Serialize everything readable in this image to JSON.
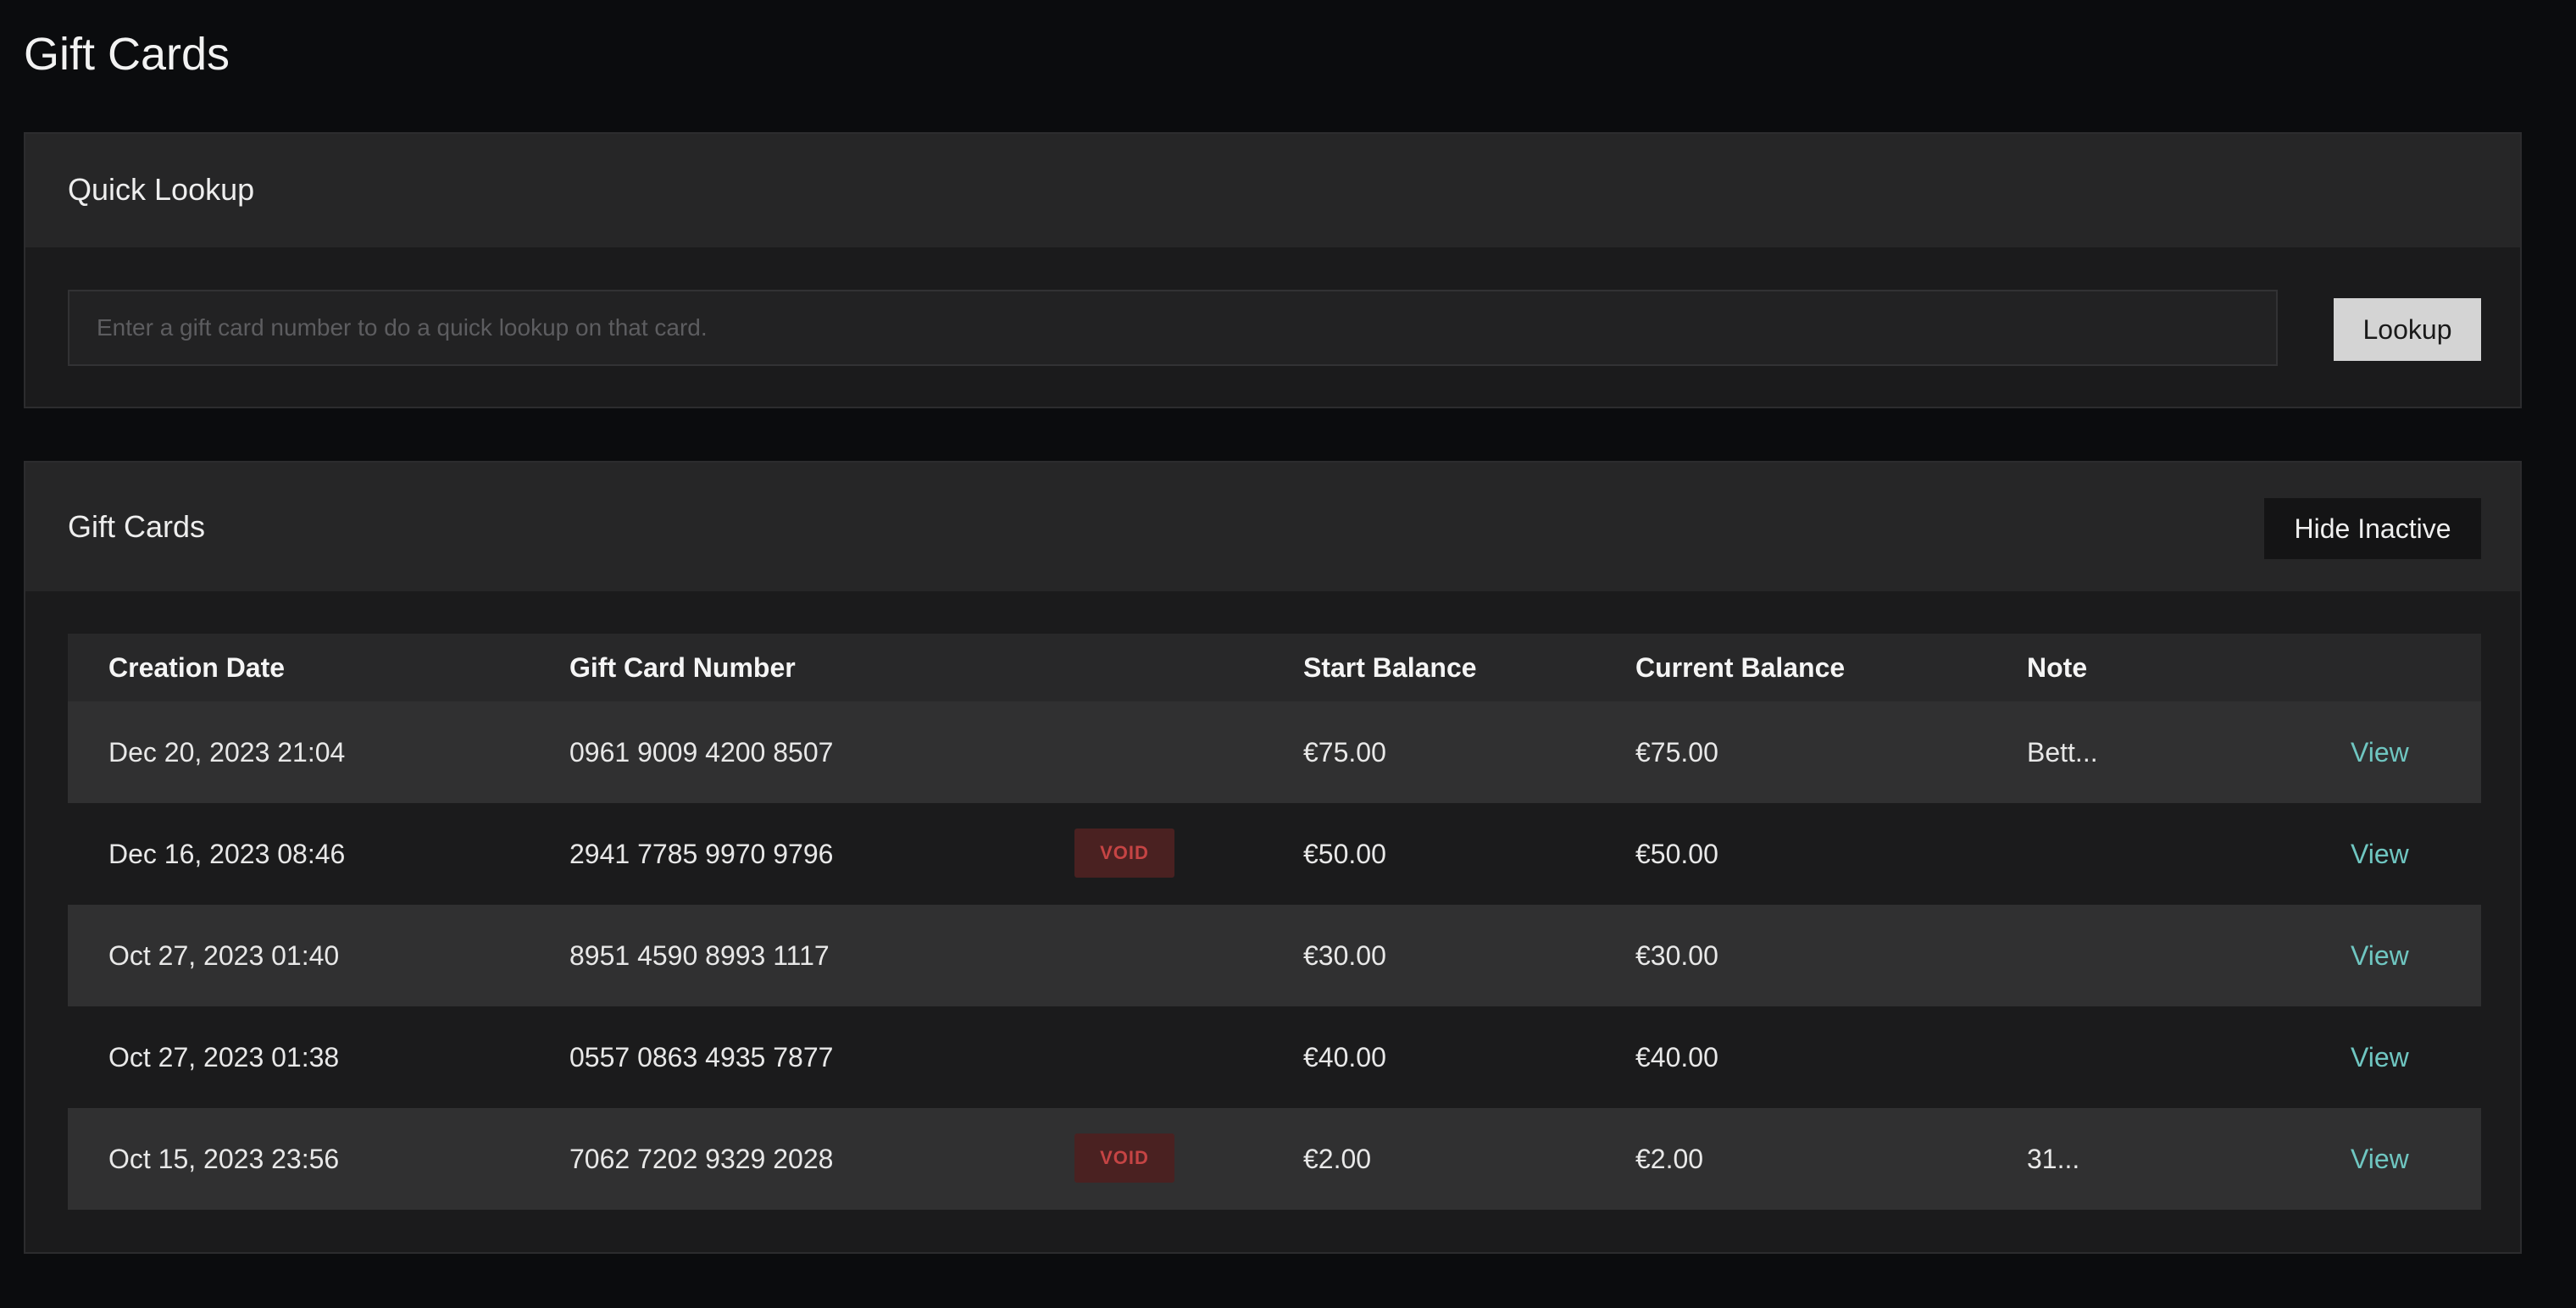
{
  "page_title": "Gift Cards",
  "lookup": {
    "title": "Quick Lookup",
    "input_value": "",
    "placeholder": "Enter a gift card number to do a quick lookup on that card.",
    "button_label": "Lookup"
  },
  "cards": {
    "title": "Gift Cards",
    "hide_inactive_label": "Hide Inactive",
    "headers": {
      "date": "Creation Date",
      "number": "Gift Card Number",
      "start": "Start Balance",
      "current": "Current Balance",
      "note": "Note"
    },
    "rows": [
      {
        "date": "Dec 20, 2023 21:04",
        "number": "0961 9009 4200 8507",
        "badge": "",
        "start": "€75.00",
        "current": "€75.00",
        "note": "Bett...",
        "action": "View"
      },
      {
        "date": "Dec 16, 2023 08:46",
        "number": "2941 7785 9970 9796",
        "badge": "VOID",
        "start": "€50.00",
        "current": "€50.00",
        "note": "",
        "action": "View"
      },
      {
        "date": "Oct 27, 2023 01:40",
        "number": "8951 4590 8993 1117",
        "badge": "",
        "start": "€30.00",
        "current": "€30.00",
        "note": "",
        "action": "View"
      },
      {
        "date": "Oct 27, 2023 01:38",
        "number": "0557 0863 4935 7877",
        "badge": "",
        "start": "€40.00",
        "current": "€40.00",
        "note": "",
        "action": "View"
      },
      {
        "date": "Oct 15, 2023 23:56",
        "number": "7062 7202 9329 2028",
        "badge": "VOID",
        "start": "€2.00",
        "current": "€2.00",
        "note": "31...",
        "action": "View"
      }
    ]
  },
  "colors": {
    "background": "#0b0c0e",
    "panel": "#1b1b1c",
    "link": "#6fc6c1",
    "void_text": "#c54444",
    "void_bg": "#4a2121"
  }
}
